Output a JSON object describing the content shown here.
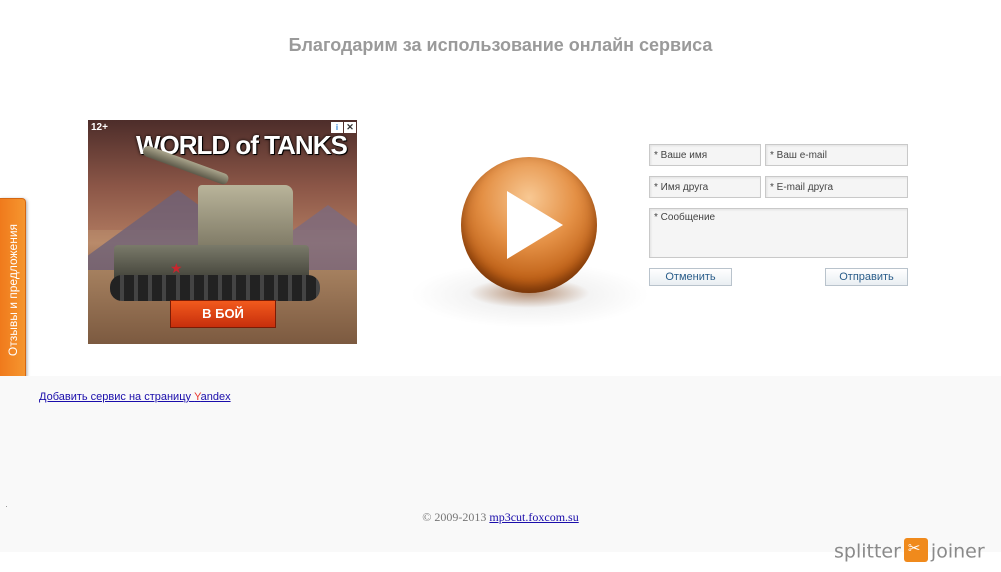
{
  "page": {
    "title": "Благодарим за использование онлайн сервиса"
  },
  "feedback_tab": {
    "label": "Отзывы и предложения"
  },
  "ad": {
    "age_rating": "12+",
    "brand": "WORLD of TANKS",
    "cta": "В БОЙ",
    "info_icon": "info-icon",
    "close_icon": "close-icon"
  },
  "form": {
    "name_placeholder": "* Ваше имя",
    "email_placeholder": "* Ваш e-mail",
    "friend_name_placeholder": "* Имя друга",
    "friend_email_placeholder": "* E-mail друга",
    "message_placeholder": "* Сообщение",
    "cancel_label": "Отменить",
    "send_label": "Отправить"
  },
  "footer": {
    "yandex_prefix": "Добавить сервис на страницу ",
    "yandex_y": "Y",
    "yandex_rest": "andex",
    "copyright_prefix": "© 2009-2013 ",
    "site_link": "mp3cut.foxcom.su"
  },
  "watermark": {
    "left": "splitter",
    "right": "joiner"
  },
  "colors": {
    "title": "#9a9a9a",
    "feedback_tab": "#f07a1c",
    "link": "#1a0dab",
    "play_button": "#e49045"
  }
}
